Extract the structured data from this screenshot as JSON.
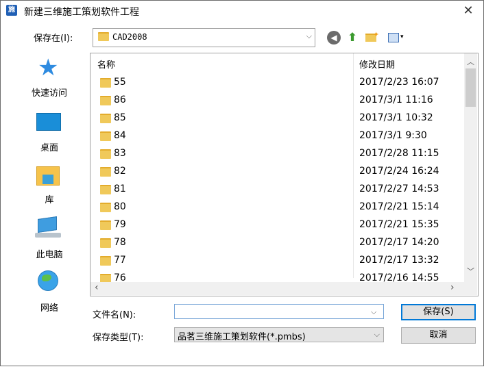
{
  "window": {
    "title": "新建三维施工策划软件工程",
    "app_icon": "施",
    "close": "✕"
  },
  "toolbar": {
    "lookin_label": "保存在(I):",
    "lookin_value": "CAD2008",
    "back_glyph": "◀",
    "up_glyph": "⬆",
    "new_glyph": "✦",
    "view_glyph": "▾",
    "combo_arrow": "⌵"
  },
  "places": [
    {
      "label": "快速访问",
      "icon": "star-icon"
    },
    {
      "label": "桌面",
      "icon": "desktop-icon"
    },
    {
      "label": "库",
      "icon": "library-icon"
    },
    {
      "label": "此电脑",
      "icon": "computer-icon"
    },
    {
      "label": "网络",
      "icon": "network-icon"
    }
  ],
  "places_star_glyph": "★",
  "filelist": {
    "col_name": "名称",
    "col_date": "修改日期",
    "rows": [
      {
        "name": "55",
        "date": "2017/2/23 16:07"
      },
      {
        "name": "86",
        "date": "2017/3/1 11:16"
      },
      {
        "name": "85",
        "date": "2017/3/1 10:32"
      },
      {
        "name": "84",
        "date": "2017/3/1 9:30"
      },
      {
        "name": "83",
        "date": "2017/2/28 11:15"
      },
      {
        "name": "82",
        "date": "2017/2/24 16:24"
      },
      {
        "name": "81",
        "date": "2017/2/27 14:53"
      },
      {
        "name": "80",
        "date": "2017/2/21 15:14"
      },
      {
        "name": "79",
        "date": "2017/2/21 15:35"
      },
      {
        "name": "78",
        "date": "2017/2/17 14:20"
      },
      {
        "name": "77",
        "date": "2017/2/17 13:32"
      },
      {
        "name": "76",
        "date": "2017/2/16 14:55"
      }
    ],
    "scroll_up": "︿",
    "scroll_down": "﹀",
    "scroll_left": "‹",
    "scroll_right": "›"
  },
  "form": {
    "filename_label": "文件名(N):",
    "filename_value": "",
    "filetype_label": "保存类型(T):",
    "filetype_value": "品茗三维施工策划软件(*.pmbs)",
    "dropdown_arrow": "⌵"
  },
  "buttons": {
    "save": "保存(S)",
    "cancel": "取消"
  }
}
